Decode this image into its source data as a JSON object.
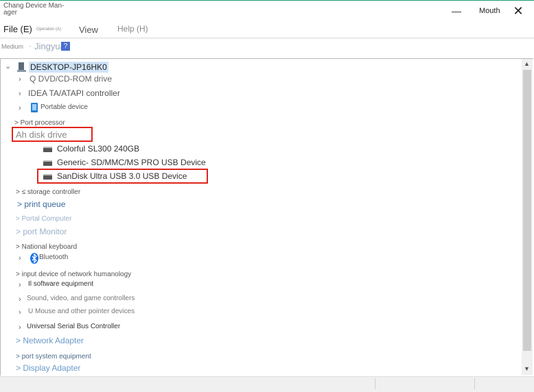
{
  "window": {
    "title": "Chang Device Manager",
    "title_line1": "Chang Device Man-",
    "title_line2": "ager",
    "minimize_glyph": "—",
    "maximize_label": "Mouth",
    "close_glyph": "✕"
  },
  "menu": {
    "file": "File (E)",
    "operation": "Operation (A)",
    "view": "View",
    "help": "Help (H)"
  },
  "toolbar": {
    "medium": "Medium",
    "separator": "·",
    "user": "Jingyuan",
    "help_icon_glyph": "?"
  },
  "tree": {
    "root": "DESKTOP-JP16HK0",
    "items": [
      {
        "label": "Q DVD/CD-ROM drive",
        "icon": "dvd-drive-icon"
      },
      {
        "label": "IDEA TA/ATAPI controller",
        "icon": "ide-controller-icon"
      },
      {
        "label": "Portable device",
        "icon": "portable-device-icon"
      },
      {
        "label": "> Port processor",
        "icon": "processor-icon"
      },
      {
        "label": "Ah disk drive",
        "icon": "disk-drive-icon",
        "expanded": true
      },
      {
        "label": "> ≤ storage controller",
        "icon": "storage-controller-icon"
      },
      {
        "label": "> print queue",
        "icon": "print-queue-icon"
      },
      {
        "label": "> Portal Computer",
        "icon": "computer-icon"
      },
      {
        "label": "> port Monitor",
        "icon": "monitor-icon"
      },
      {
        "label": "> National keyboard",
        "icon": "keyboard-icon"
      },
      {
        "label": "Bluetooth",
        "icon": "bluetooth-icon"
      },
      {
        "label": "> input device of network humanology",
        "icon": "input-device-icon"
      },
      {
        "label": "Il software equipment",
        "icon": "software-device-icon"
      },
      {
        "label": "Sound, video, and game controllers",
        "icon": "sound-icon"
      },
      {
        "label": "U Mouse and other pointer devices",
        "icon": "mouse-icon"
      },
      {
        "label": "Universal Serial Bus Controller",
        "icon": "usb-icon"
      },
      {
        "label": "> Network Adapter",
        "icon": "network-adapter-icon"
      },
      {
        "label": "> port system equipment",
        "icon": "system-device-icon"
      },
      {
        "label": "> Display Adapter",
        "icon": "display-adapter-icon"
      }
    ],
    "disk_children": [
      {
        "label": "Colorful SL300 240GB"
      },
      {
        "label": "Generic- SD/MMC/MS PRO USB Device"
      },
      {
        "label": "SanDisk Ultra USB 3.0 USB Device",
        "highlighted": true
      }
    ]
  },
  "colors": {
    "highlight_border": "#e0241b",
    "root_selection": "#cfe3f7",
    "title_accent": "#1a9c6a"
  }
}
